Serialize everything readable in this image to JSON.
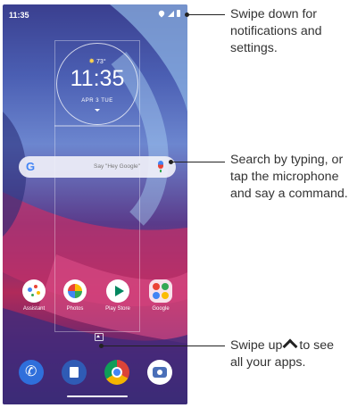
{
  "status_bar": {
    "time": "11:35"
  },
  "clock_widget": {
    "temperature": "73°",
    "time": "11:35",
    "date": "APR 3 TUE"
  },
  "search_bar": {
    "placeholder": "Say \"Hey Google\"",
    "logo": "G"
  },
  "apps": [
    {
      "label": "Assistant",
      "icon": "assistant-icon"
    },
    {
      "label": "Photos",
      "icon": "photos-icon"
    },
    {
      "label": "Play Store",
      "icon": "play-store-icon"
    },
    {
      "label": "Google",
      "icon": "google-folder-icon"
    }
  ],
  "dock": [
    {
      "icon": "phone-icon"
    },
    {
      "icon": "messages-icon"
    },
    {
      "icon": "chrome-icon"
    },
    {
      "icon": "camera-icon"
    }
  ],
  "callouts": {
    "notifications": [
      "Swipe down for",
      "notifications and",
      "settings."
    ],
    "search": [
      "Search by typing, or",
      "tap the microphone",
      "and say a command."
    ],
    "apps_prefix": "Swipe up",
    "apps_suffix": "to see",
    "apps_line2": "all your apps."
  }
}
